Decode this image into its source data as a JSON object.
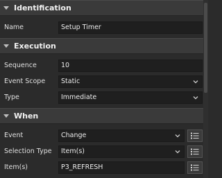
{
  "sections": {
    "identification": {
      "title": "Identification",
      "name_label": "Name",
      "name_value": "Setup Timer"
    },
    "execution": {
      "title": "Execution",
      "sequence_label": "Sequence",
      "sequence_value": "10",
      "event_scope_label": "Event Scope",
      "event_scope_value": "Static",
      "type_label": "Type",
      "type_value": "Immediate"
    },
    "when": {
      "title": "When",
      "event_label": "Event",
      "event_value": "Change",
      "selection_type_label": "Selection Type",
      "selection_type_value": "Item(s)",
      "items_label": "Item(s)",
      "items_value": "P3_REFRESH"
    }
  },
  "icons": {
    "collapse": "caret-down-icon",
    "dropdown": "chevron-down-icon",
    "list": "list-icon"
  }
}
